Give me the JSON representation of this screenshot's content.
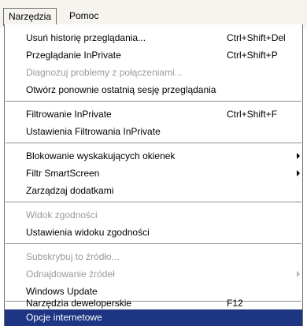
{
  "menubar": {
    "items": [
      {
        "label": "Narzędzia"
      },
      {
        "label": "Pomoc"
      }
    ]
  },
  "menu": {
    "items": [
      {
        "label": "Usuń historię przeglądania...",
        "shortcut": "Ctrl+Shift+Del"
      },
      {
        "label": "Przeglądanie InPrivate",
        "shortcut": "Ctrl+Shift+P"
      },
      {
        "label": "Diagnozuj problemy z połączeniami...",
        "disabled": true
      },
      {
        "label": "Otwórz ponownie ostatnią sesję przeglądania"
      },
      {
        "label": "Filtrowanie InPrivate",
        "shortcut": "Ctrl+Shift+F"
      },
      {
        "label": "Ustawienia Filtrowania InPrivate"
      },
      {
        "label": "Blokowanie wyskakujących okienek",
        "submenu": true
      },
      {
        "label": "Filtr SmartScreen",
        "submenu": true
      },
      {
        "label": "Zarządzaj dodatkami"
      },
      {
        "label": "Widok zgodności",
        "disabled": true
      },
      {
        "label": "Ustawienia widoku zgodności"
      },
      {
        "label": "Subskrybuj to źródło...",
        "disabled": true
      },
      {
        "label": "Odnajdowanie źródeł",
        "disabled": true,
        "submenu": true
      },
      {
        "label": "Windows Update"
      },
      {
        "label": "Narzędzia deweloperskie",
        "shortcut": "F12"
      },
      {
        "label": "Opcje internetowe",
        "highlighted": true
      }
    ]
  },
  "colors": {
    "highlight": "#1d3582",
    "disabled_text": "#9a9a9a",
    "menubar_bg": "#f5f4ef"
  }
}
